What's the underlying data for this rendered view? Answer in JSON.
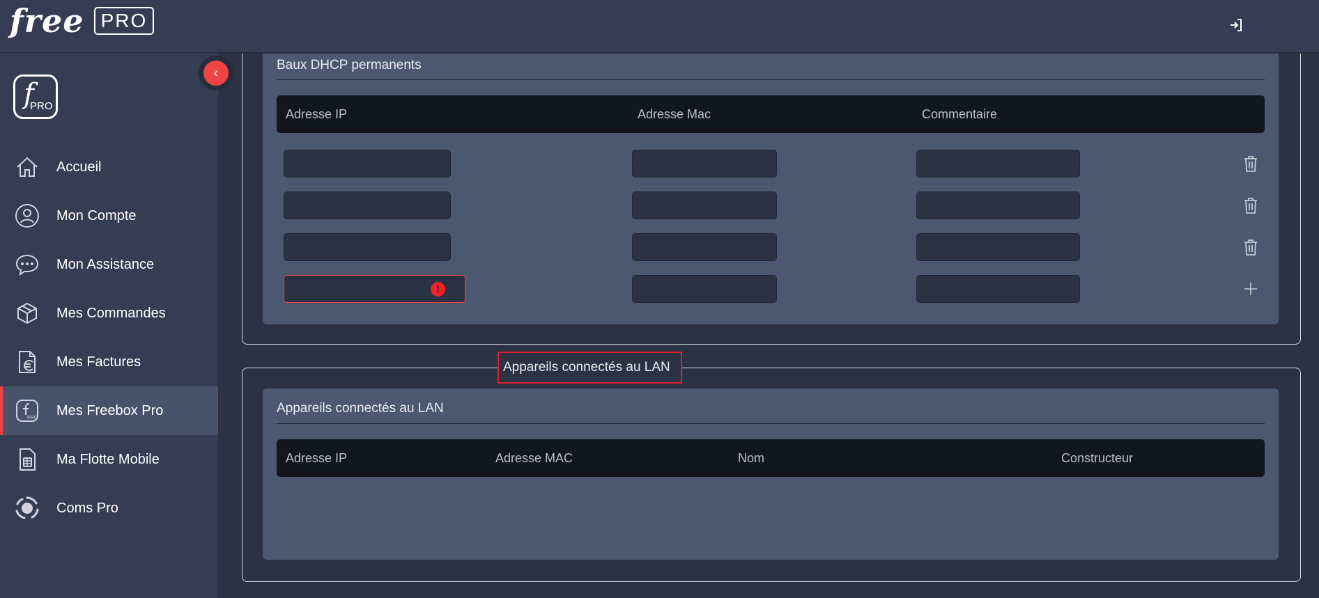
{
  "brand": {
    "name": "free",
    "badge": "PRO",
    "sidebar_logo_letter": "f",
    "sidebar_logo_sub": "PRO"
  },
  "header": {
    "logout_icon": "logout-icon"
  },
  "sidebar": {
    "collapse_glyph": "‹",
    "items": [
      {
        "label": "Accueil",
        "icon": "home-icon",
        "active": false
      },
      {
        "label": "Mon Compte",
        "icon": "user-icon",
        "active": false
      },
      {
        "label": "Mon Assistance",
        "icon": "chat-icon",
        "active": false
      },
      {
        "label": "Mes Commandes",
        "icon": "box-icon",
        "active": false
      },
      {
        "label": "Mes Factures",
        "icon": "invoice-euro-icon",
        "active": false
      },
      {
        "label": "Mes Freebox Pro",
        "icon": "freebox-pro-icon",
        "active": true
      },
      {
        "label": "Ma Flotte Mobile",
        "icon": "sim-card-icon",
        "active": false
      },
      {
        "label": "Coms Pro",
        "icon": "coms-pro-icon",
        "active": false
      }
    ]
  },
  "dhcp": {
    "title": "Baux DHCP permanents",
    "columns": [
      "Adresse IP",
      "Adresse Mac",
      "Commentaire"
    ],
    "rows": [
      {
        "ip": "",
        "mac": "",
        "comment": "",
        "action": "delete"
      },
      {
        "ip": "",
        "mac": "",
        "comment": "",
        "action": "delete"
      },
      {
        "ip": "",
        "mac": "",
        "comment": "",
        "action": "delete"
      },
      {
        "ip": "",
        "mac": "",
        "comment": "",
        "action": "add",
        "ip_error": true
      }
    ],
    "error_glyph": "!"
  },
  "lan": {
    "legend": "Appareils connectés au LAN",
    "title": "Appareils connectés au LAN",
    "columns": [
      "Adresse IP",
      "Adresse MAC",
      "Nom",
      "Constructeur"
    ]
  },
  "colors": {
    "accent": "#ef4444",
    "highlight_border": "#e11d2e",
    "sidebar_bg": "#343d52",
    "card_bg": "#4c5870"
  }
}
